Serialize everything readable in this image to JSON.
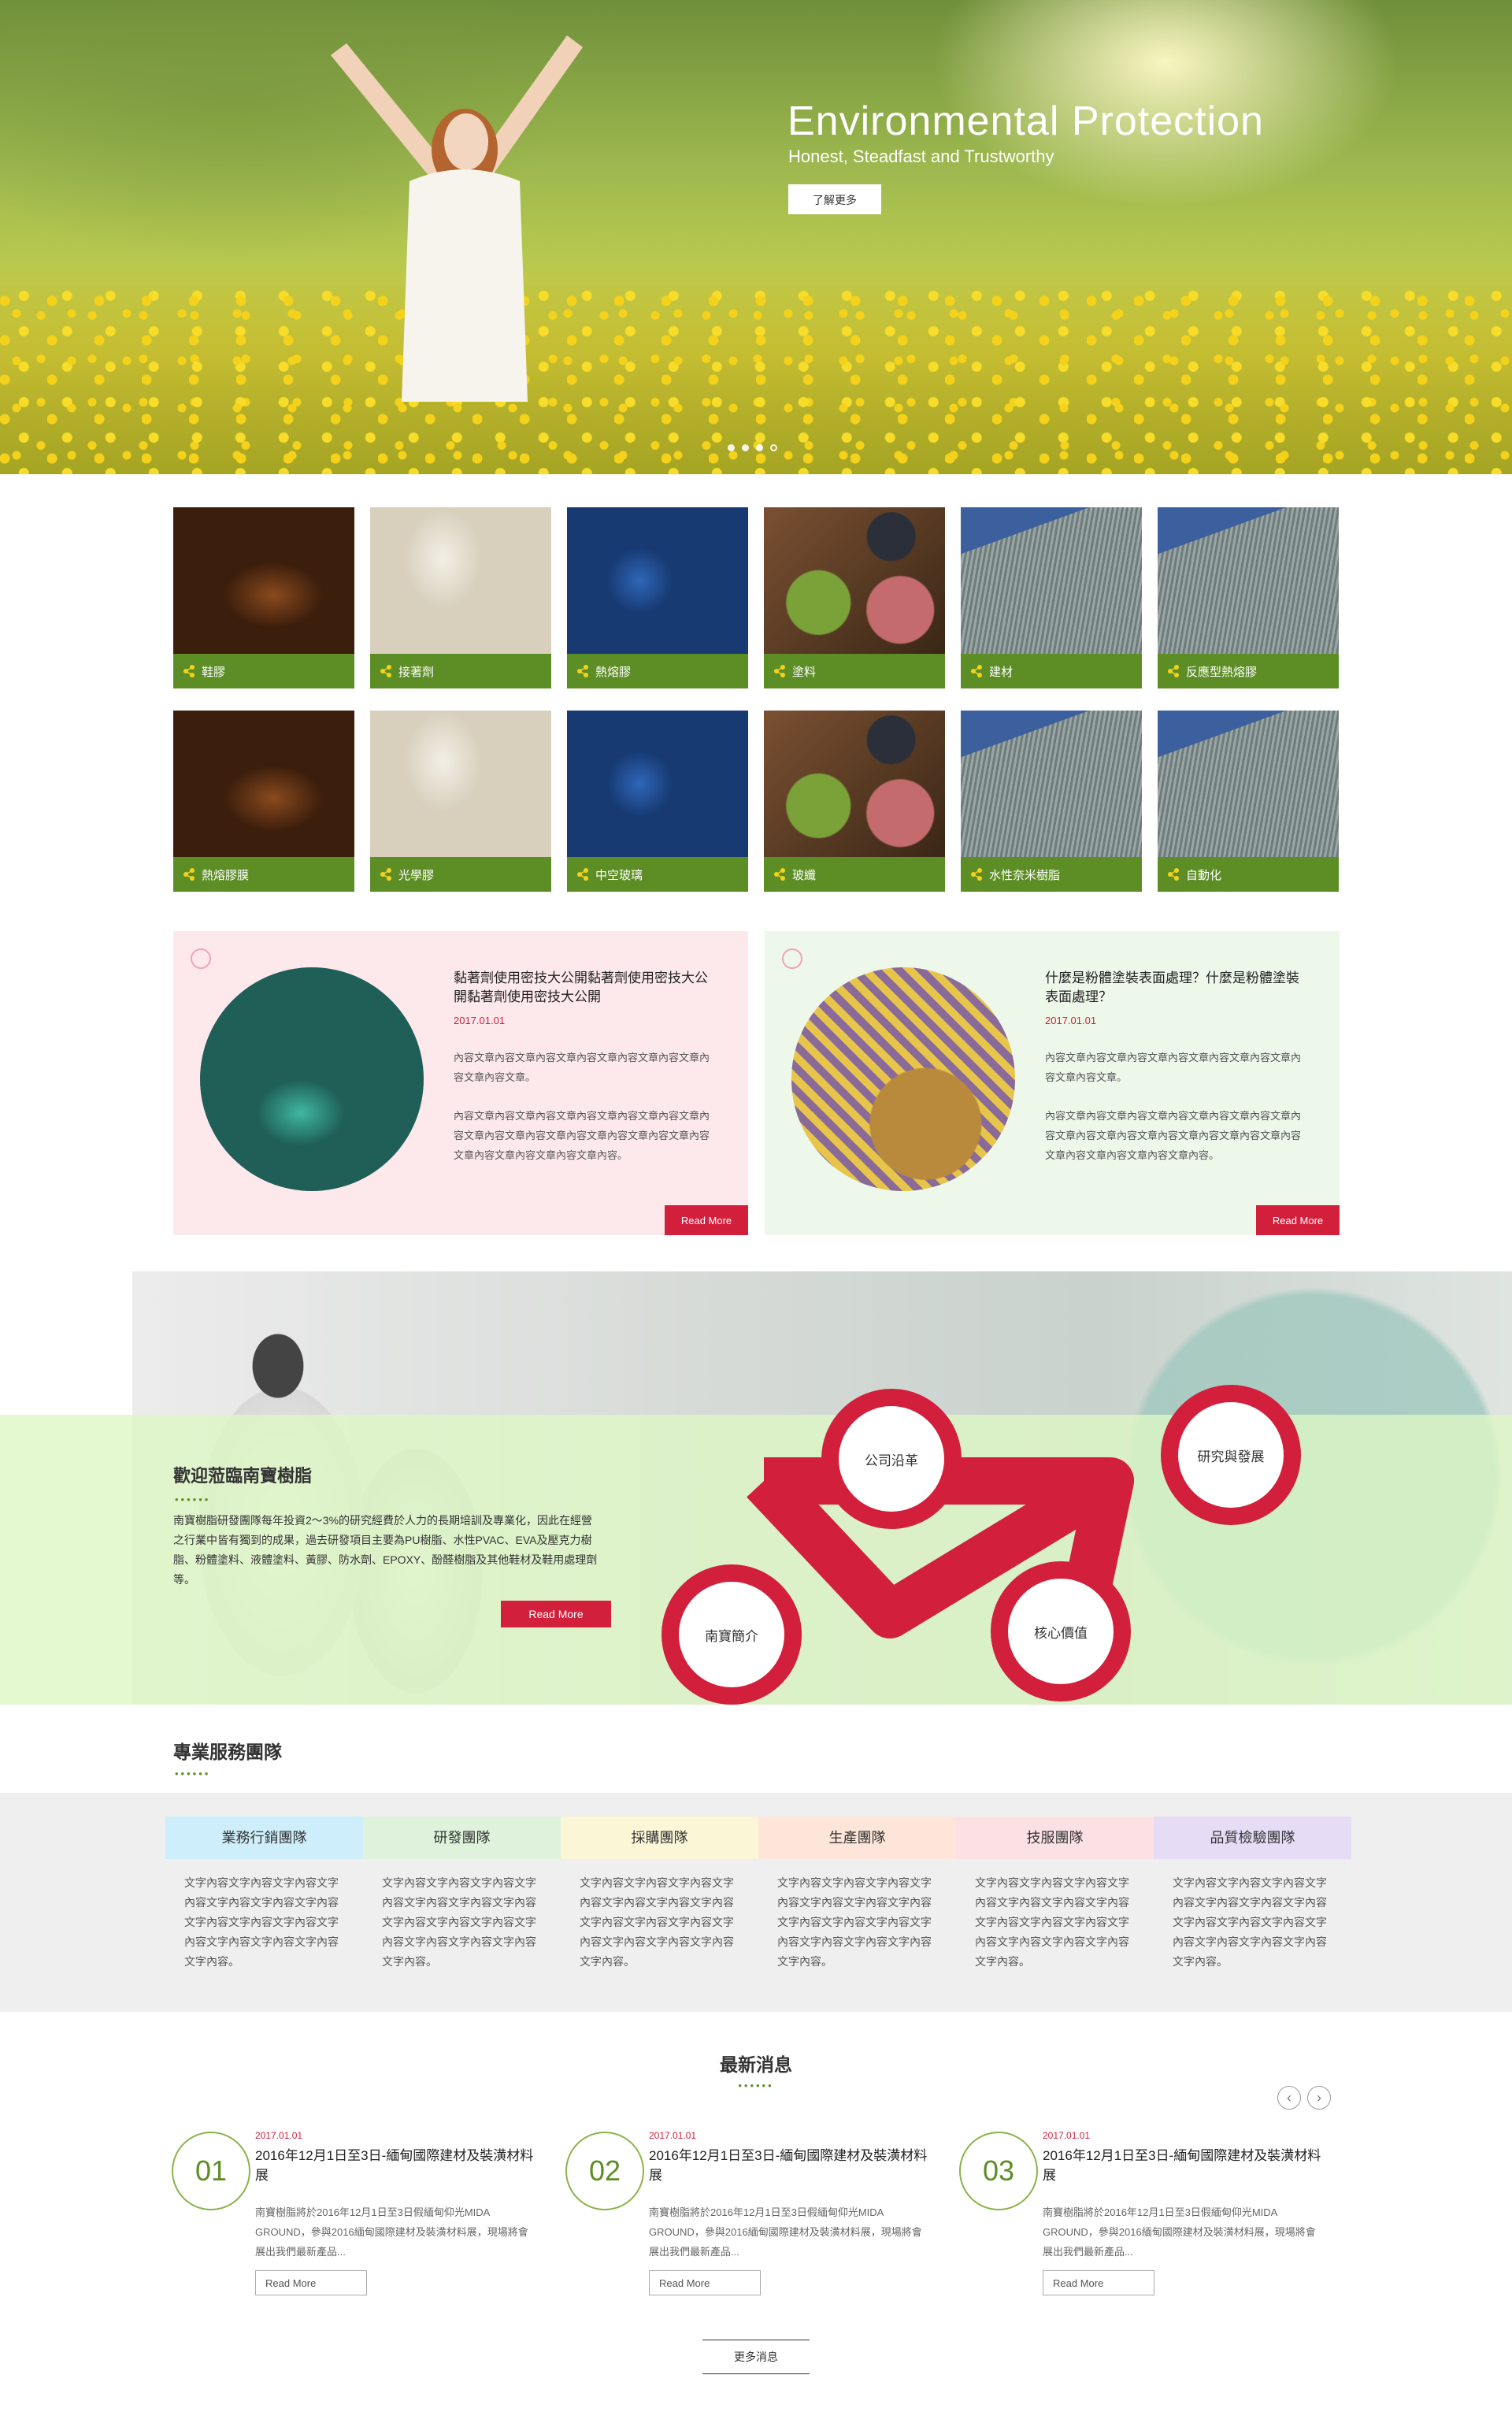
{
  "hero": {
    "title": "Environmental Protection",
    "subtitle": "Honest, Steadfast and Trustworthy",
    "button": "了解更多",
    "slides": 4,
    "active_slide": 4
  },
  "products": {
    "row1": [
      "鞋膠",
      "接著劑",
      "熱熔膠",
      "塗料",
      "建材",
      "反應型熱熔膠"
    ],
    "row2": [
      "熱熔膠膜",
      "光學膠",
      "中空玻璃",
      "玻纖",
      "水性奈米樹脂",
      "自動化"
    ]
  },
  "articles": [
    {
      "title": "黏著劑使用密技大公開黏著劑使用密技大公開黏著劑使用密技大公開",
      "date": "2017.01.01",
      "p1": "內容文章內容文章內容文章內容文章內容文章內容文章內容文章內容文章。",
      "p2": "內容文章內容文章內容文章內容文章內容文章內容文章內容文章內容文章內容文章內容文章內容文章內容文章內容文章內容文章內容文章內容文章內容。",
      "button": "Read More"
    },
    {
      "title": "什麼是粉體塗裝表面處理？什麼是粉體塗裝表面處理？",
      "date": "2017.01.01",
      "p1": "內容文章內容文章內容文章內容文章內容文章內容文章內容文章內容文章。",
      "p2": "內容文章內容文章內容文章內容文章內容文章內容文章內容文章內容文章內容文章內容文章內容文章內容文章內容文章內容文章內容文章內容文章內容。",
      "button": "Read More"
    }
  ],
  "about": {
    "title": "歡迎蒞臨南寶樹脂",
    "dots": "••••••",
    "text": "南寶樹脂研發團隊每年投資2～3%的研究經費於人力的長期培訓及專業化，因此在經營之行業中皆有獨到的成果，過去研發項目主要為PU樹脂、水性PVAC、EVA及壓克力樹脂、粉體塗料、液體塗料、黃膠、防水劑、EPOXY、酚醛樹脂及其他鞋材及鞋用處理劑等。",
    "button": "Read More",
    "nodes": [
      "公司沿革",
      "研究與發展",
      "南寶簡介",
      "核心價值"
    ]
  },
  "team": {
    "title": "專業服務團隊",
    "dots": "••••••",
    "columns": [
      {
        "name": "業務行銷團隊",
        "color": "#cdeefa",
        "text": "文字內容文字內容文字內容文字內容文字內容文字內容文字內容文字內容文字內容文字內容文字內容文字內容文字內容文字內容文字內容。"
      },
      {
        "name": "研發團隊",
        "color": "#dff3dc",
        "text": "文字內容文字內容文字內容文字內容文字內容文字內容文字內容文字內容文字內容文字內容文字內容文字內容文字內容文字內容文字內容。"
      },
      {
        "name": "採購團隊",
        "color": "#fbf6d6",
        "text": "文字內容文字內容文字內容文字內容文字內容文字內容文字內容文字內容文字內容文字內容文字內容文字內容文字內容文字內容文字內容。"
      },
      {
        "name": "生產團隊",
        "color": "#fde6d9",
        "text": "文字內容文字內容文字內容文字內容文字內容文字內容文字內容文字內容文字內容文字內容文字內容文字內容文字內容文字內容文字內容。"
      },
      {
        "name": "技服團隊",
        "color": "#fbe0e4",
        "text": "文字內容文字內容文字內容文字內容文字內容文字內容文字內容文字內容文字內容文字內容文字內容文字內容文字內容文字內容文字內容。"
      },
      {
        "name": "品質檢驗團隊",
        "color": "#e7dcf6",
        "text": "文字內容文字內容文字內容文字內容文字內容文字內容文字內容文字內容文字內容文字內容文字內容文字內容文字內容文字內容文字內容。"
      }
    ]
  },
  "news": {
    "title": "最新消息",
    "dots": "••••••",
    "prev": "‹",
    "next": "›",
    "items": [
      {
        "num": "01",
        "date": "2017.01.01",
        "title": "2016年12月1日至3日-緬甸國際建材及裝潢材料展",
        "body": "南寶樹脂將於2016年12月1日至3日假緬甸仰光MIDA GROUND，參與2016緬甸國際建材及裝潢材料展，現場將會展出我們最新產品...",
        "button": "Read More"
      },
      {
        "num": "02",
        "date": "2017.01.01",
        "title": "2016年12月1日至3日-緬甸國際建材及裝潢材料展",
        "body": "南寶樹脂將於2016年12月1日至3日假緬甸仰光MIDA GROUND，參與2016緬甸國際建材及裝潢材料展，現場將會展出我們最新產品...",
        "button": "Read More"
      },
      {
        "num": "03",
        "date": "2017.01.01",
        "title": "2016年12月1日至3日-緬甸國際建材及裝潢材料展",
        "body": "南寶樹脂將於2016年12月1日至3日假緬甸仰光MIDA GROUND，參與2016緬甸國際建材及裝潢材料展，現場將會展出我們最新產品...",
        "button": "Read More"
      }
    ],
    "more": "更多消息"
  },
  "colors": {
    "green": "#5d8e25",
    "red": "#d21f3c"
  }
}
